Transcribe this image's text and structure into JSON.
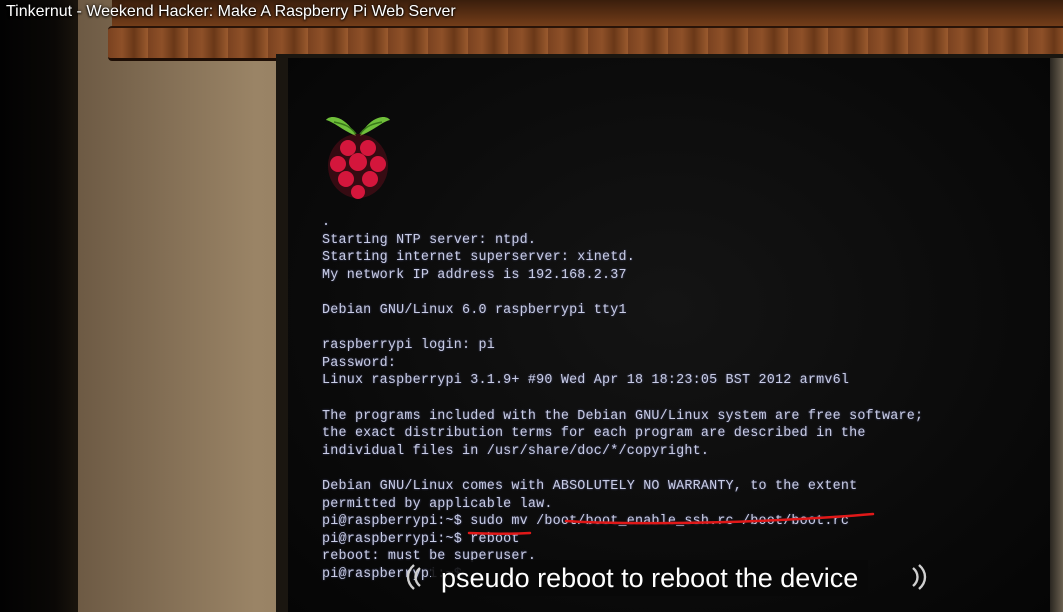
{
  "video": {
    "title": "Tinkernut - Weekend Hacker: Make A Raspberry Pi Web Server"
  },
  "screen": {
    "logo_icon": "raspberry-pi-logo-icon",
    "terminal_lines": [
      ".",
      "Starting NTP server: ntpd.",
      "Starting internet superserver: xinetd.",
      "My network IP address is 192.168.2.37",
      "",
      "Debian GNU/Linux 6.0 raspberrypi tty1",
      "",
      "raspberrypi login: pi",
      "Password:",
      "Linux raspberrypi 3.1.9+ #90 Wed Apr 18 18:23:05 BST 2012 armv6l",
      "",
      "The programs included with the Debian GNU/Linux system are free software;",
      "the exact distribution terms for each program are described in the",
      "individual files in /usr/share/doc/*/copyright.",
      "",
      "Debian GNU/Linux comes with ABSOLUTELY NO WARRANTY, to the extent",
      "permitted by applicable law.",
      "pi@raspberrypi:~$ sudo mv /boot/boot_enable_ssh.rc /boot/boot.rc",
      "pi@raspberrypi:~$ reboot",
      "reboot: must be superuser.",
      "pi@raspberrypi:~$"
    ],
    "annotation_color": "#e01818"
  },
  "caption": {
    "text": "pseudo reboot to reboot the device",
    "icon": "sound-waves-icon"
  }
}
